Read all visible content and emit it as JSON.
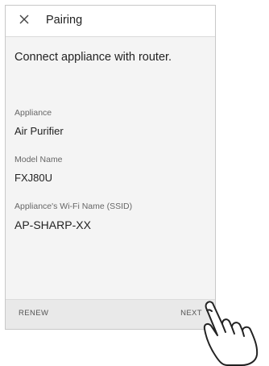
{
  "appbar": {
    "close_icon": "close-icon",
    "title": "Pairing"
  },
  "main": {
    "heading": "Connect appliance with router.",
    "fields": [
      {
        "label": "Appliance",
        "value": "Air Purifier"
      },
      {
        "label": "Model Name",
        "value": "FXJ80U"
      },
      {
        "label": "Appliance's Wi-Fi Name (SSID)",
        "value": "AP-SHARP-XX"
      }
    ]
  },
  "footer": {
    "renew_label": "RENEW",
    "next_label": "NEXT"
  },
  "overlay": {
    "hand_icon": "pointing-hand-icon"
  }
}
